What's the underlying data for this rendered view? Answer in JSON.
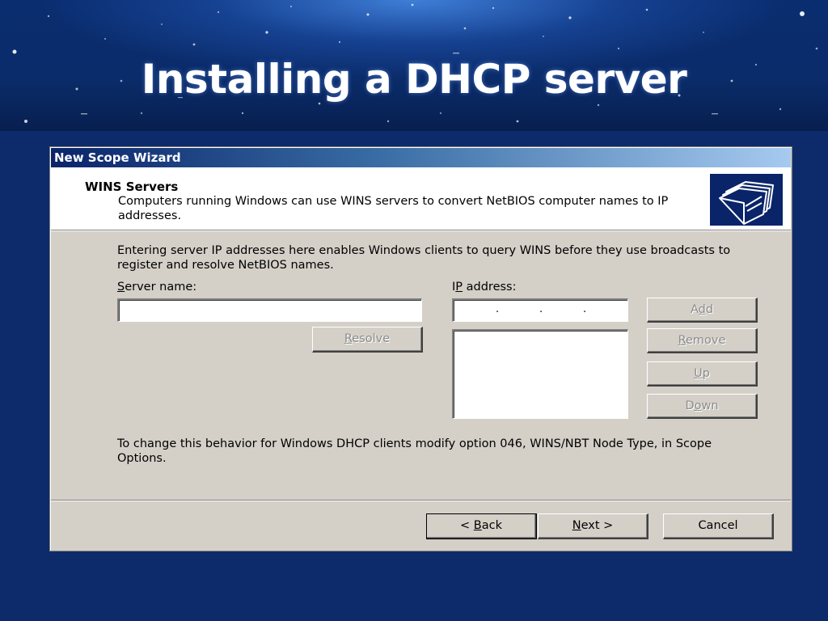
{
  "slide": {
    "title": "Installing a DHCP server",
    "colors": {
      "background": "#0c2a6a",
      "title_text": "#ffffff"
    }
  },
  "dialog": {
    "title": "New Scope Wizard",
    "header": {
      "title": "WINS Servers",
      "description": "Computers running Windows can use WINS servers to convert NetBIOS computer names to IP addresses.",
      "icon": "folders-icon"
    },
    "info_text": "Entering server IP addresses here enables Windows clients to query WINS before they use broadcasts to register and resolve NetBIOS names.",
    "server_name": {
      "label_accel": "S",
      "label_rest": "erver name:",
      "value": ""
    },
    "ip_address": {
      "label_pre": "I",
      "label_accel": "P",
      "label_rest": " address:",
      "value": ""
    },
    "buttons": {
      "resolve": {
        "accel": "R",
        "rest": "esolve",
        "enabled": false
      },
      "add": {
        "pre": "A",
        "accel": "d",
        "rest": "d",
        "enabled": false
      },
      "remove": {
        "accel": "R",
        "rest": "emove",
        "enabled": false
      },
      "up": {
        "accel": "U",
        "rest": "p",
        "enabled": false
      },
      "down": {
        "pre": "D",
        "accel": "o",
        "rest": "wn",
        "enabled": false
      }
    },
    "ip_list": [],
    "bottom_text": "To change this behavior for Windows DHCP clients modify option 046, WINS/NBT Node Type, in Scope Options.",
    "footer": {
      "back": {
        "pre": "< ",
        "accel": "B",
        "rest": "ack"
      },
      "next": {
        "accel": "N",
        "rest": "ext >"
      },
      "cancel": "Cancel"
    },
    "colors": {
      "face": "#d4d0c8",
      "title_start": "#0a246a",
      "title_end": "#a6caf0",
      "disabled_text": "#8c8c8c"
    }
  }
}
